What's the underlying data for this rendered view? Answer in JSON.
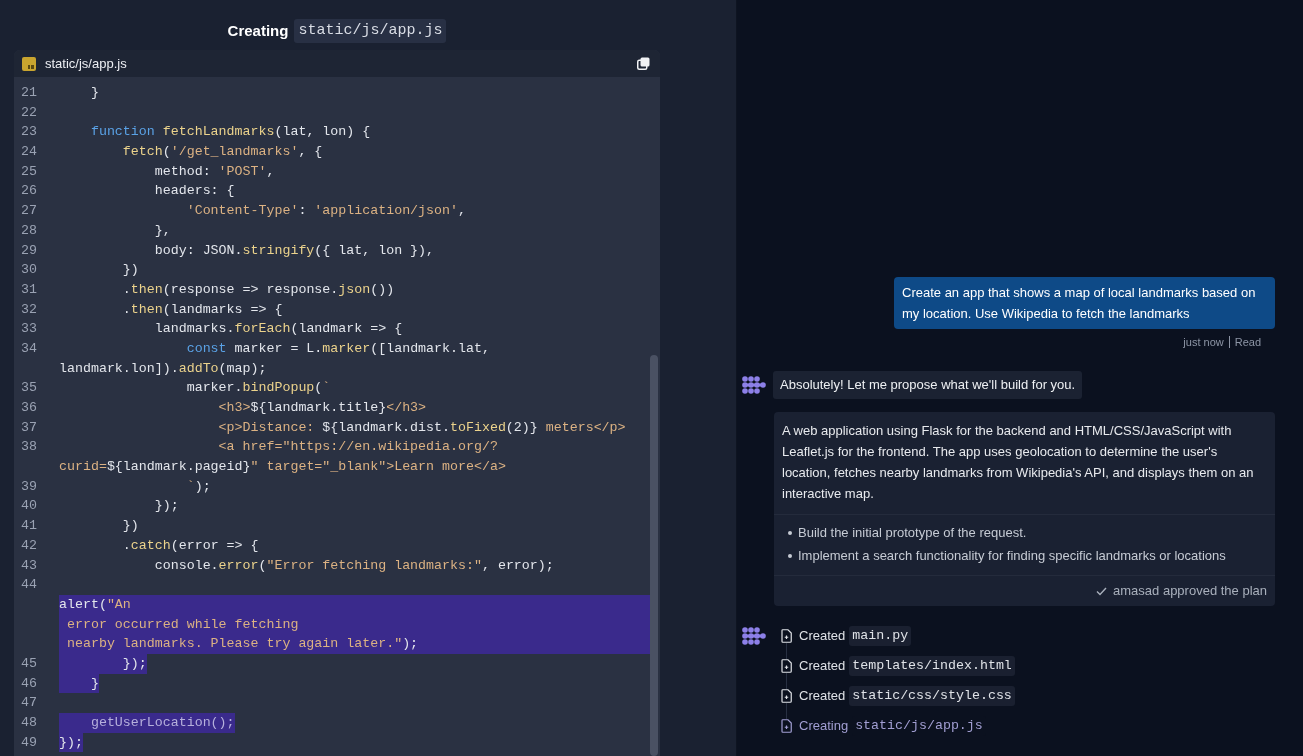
{
  "editor": {
    "heading": {
      "verb": "Creating",
      "path": "static/js/app.js"
    },
    "file_tab": {
      "name": "static/js/app.js"
    },
    "lines": [
      {
        "number": "21",
        "tokens": [
          {
            "text": "    }",
            "kind": "plain"
          }
        ]
      },
      {
        "number": "22"
      },
      {
        "number": "23",
        "tokens": [
          {
            "text": "    function",
            "kind": "keyword"
          },
          {
            "text": " fetchLandmarks",
            "kind": "function"
          },
          {
            "text": "(lat, lon) {",
            "kind": "plain"
          }
        ]
      },
      {
        "number": "24",
        "tokens": [
          {
            "text": "        fetch",
            "kind": "function"
          },
          {
            "text": "(",
            "kind": "plain"
          },
          {
            "text": "'/get_landmarks'",
            "kind": "string"
          },
          {
            "text": ", {",
            "kind": "plain"
          }
        ]
      },
      {
        "number": "25",
        "tokens": [
          {
            "text": "            method: ",
            "kind": "plain"
          },
          {
            "text": "'POST'",
            "kind": "string"
          },
          {
            "text": ",",
            "kind": "plain"
          }
        ]
      },
      {
        "number": "26",
        "tokens": [
          {
            "text": "            headers: {",
            "kind": "plain"
          }
        ]
      },
      {
        "number": "27",
        "tokens": [
          {
            "text": "                'Content-Type'",
            "kind": "string"
          },
          {
            "text": ": ",
            "kind": "plain"
          },
          {
            "text": "'application/json'",
            "kind": "string"
          },
          {
            "text": ",",
            "kind": "plain"
          }
        ]
      },
      {
        "number": "28",
        "tokens": [
          {
            "text": "            },",
            "kind": "plain"
          }
        ]
      },
      {
        "number": "29",
        "tokens": [
          {
            "text": "            body: JSON.",
            "kind": "plain"
          },
          {
            "text": "stringify",
            "kind": "function"
          },
          {
            "text": "({ lat, lon }),",
            "kind": "plain"
          }
        ]
      },
      {
        "number": "30",
        "tokens": [
          {
            "text": "        })",
            "kind": "plain"
          }
        ]
      },
      {
        "number": "31",
        "tokens": [
          {
            "text": "        .",
            "kind": "plain"
          },
          {
            "text": "then",
            "kind": "function"
          },
          {
            "text": "(response => response.",
            "kind": "plain"
          },
          {
            "text": "json",
            "kind": "function"
          },
          {
            "text": "())",
            "kind": "plain"
          }
        ]
      },
      {
        "number": "32",
        "tokens": [
          {
            "text": "        .",
            "kind": "plain"
          },
          {
            "text": "then",
            "kind": "function"
          },
          {
            "text": "(landmarks => {",
            "kind": "plain"
          }
        ]
      },
      {
        "number": "33",
        "tokens": [
          {
            "text": "            landmarks.",
            "kind": "plain"
          },
          {
            "text": "forEach",
            "kind": "function"
          },
          {
            "text": "(landmark => {",
            "kind": "plain"
          }
        ]
      },
      {
        "number": "34",
        "tokens": [
          {
            "text": "                const",
            "kind": "keyword"
          },
          {
            "text": " marker = L.",
            "kind": "plain"
          },
          {
            "text": "marker",
            "kind": "function"
          },
          {
            "text": "([landmark.lat,",
            "kind": "plain"
          }
        ]
      },
      {
        "tokens": [
          {
            "text": "landmark.lon]).",
            "kind": "plain"
          },
          {
            "text": "addTo",
            "kind": "function"
          },
          {
            "text": "(map);",
            "kind": "plain"
          }
        ]
      },
      {
        "number": "35",
        "tokens": [
          {
            "text": "                marker.",
            "kind": "plain"
          },
          {
            "text": "bindPopup",
            "kind": "function"
          },
          {
            "text": "(",
            "kind": "plain"
          },
          {
            "text": "`",
            "kind": "string"
          }
        ]
      },
      {
        "number": "36",
        "tokens": [
          {
            "text": "                    <h3>",
            "kind": "string"
          },
          {
            "text": "${landmark.title}",
            "kind": "plain"
          },
          {
            "text": "</h3>",
            "kind": "string"
          }
        ]
      },
      {
        "number": "37",
        "tokens": [
          {
            "text": "                    <p>Distance: ",
            "kind": "string"
          },
          {
            "text": "${landmark.dist.",
            "kind": "plain"
          },
          {
            "text": "toFixed",
            "kind": "function"
          },
          {
            "text": "(2)}",
            "kind": "plain"
          },
          {
            "text": " meters</p>",
            "kind": "string"
          }
        ]
      },
      {
        "number": "38",
        "tokens": [
          {
            "text": "                    <a href=\"https://en.wikipedia.org/?",
            "kind": "string"
          }
        ]
      },
      {
        "tokens": [
          {
            "text": "curid=",
            "kind": "string"
          },
          {
            "text": "${landmark.pageid}",
            "kind": "plain"
          },
          {
            "text": "\" target=\"_blank\">Learn more</a>",
            "kind": "string"
          }
        ]
      },
      {
        "number": "39",
        "tokens": [
          {
            "text": "                `",
            "kind": "string"
          },
          {
            "text": ");",
            "kind": "plain"
          }
        ]
      },
      {
        "number": "40",
        "tokens": [
          {
            "text": "            });",
            "kind": "plain"
          }
        ]
      },
      {
        "number": "41",
        "tokens": [
          {
            "text": "        })",
            "kind": "plain"
          }
        ]
      },
      {
        "number": "42",
        "tokens": [
          {
            "text": "        .",
            "kind": "plain"
          },
          {
            "text": "catch",
            "kind": "function"
          },
          {
            "text": "(error => {",
            "kind": "plain"
          }
        ]
      },
      {
        "number": "43",
        "tokens": [
          {
            "text": "            console.",
            "kind": "plain"
          },
          {
            "text": "error",
            "kind": "function"
          },
          {
            "text": "(",
            "kind": "plain"
          },
          {
            "text": "\"Error fetching landmarks:\"",
            "kind": "string"
          },
          {
            "text": ", error);",
            "kind": "plain"
          }
        ]
      },
      {
        "number": "44"
      },
      {
        "highlighted": true,
        "full_width": true,
        "tokens": [
          {
            "text": "alert(",
            "kind": "plain"
          },
          {
            "text": "\"An",
            "kind": "string"
          }
        ]
      },
      {
        "highlighted": true,
        "full_width": true,
        "tokens": [
          {
            "text": " error occurred while fetching",
            "kind": "string"
          }
        ]
      },
      {
        "highlighted": true,
        "full_width": true,
        "tokens": [
          {
            "text": " nearby landmarks. Please try again later.\"",
            "kind": "string"
          },
          {
            "text": ");",
            "kind": "plain"
          }
        ]
      },
      {
        "number": "45",
        "highlighted": true,
        "full_width": false,
        "tokens": [
          {
            "text": "        });",
            "kind": "plain"
          }
        ]
      },
      {
        "number": "46",
        "highlighted": true,
        "full_width": false,
        "tokens": [
          {
            "text": "    }",
            "kind": "plain"
          }
        ]
      },
      {
        "number": "47"
      },
      {
        "number": "48",
        "highlighted": true,
        "full_width": false,
        "tokens": [
          {
            "text": "    getUserLocation();",
            "kind": "faded"
          }
        ]
      },
      {
        "number": "49",
        "highlighted": true,
        "full_width": false,
        "tokens": [
          {
            "text": "});",
            "kind": "plain"
          }
        ]
      }
    ]
  },
  "chat": {
    "messages": [
      {
        "kind": "user",
        "text": "Create an app that shows a map of local landmarks based on my location. Use Wikipedia to fetch the landmarks",
        "time": "just now",
        "receipt": "Read"
      },
      {
        "kind": "agent",
        "text": "Absolutely! Let me propose what we'll build for you."
      },
      {
        "kind": "plan",
        "description": "A web application using Flask for the backend and HTML/CSS/JavaScript with Leaflet.js for the frontend. The app uses geolocation to determine the user's location, fetches nearby landmarks from Wikipedia's API, and displays them on an interactive map.",
        "steps": [
          "Build the initial prototype of the request.",
          "Implement a search functionality for finding specific landmarks or locations"
        ],
        "approval": "amasad approved the plan"
      },
      {
        "kind": "files",
        "items": [
          {
            "verb": "Created",
            "path": "main.py",
            "in_progress": false
          },
          {
            "verb": "Created",
            "path": "templates/index.html",
            "in_progress": false
          },
          {
            "verb": "Created",
            "path": "static/css/style.css",
            "in_progress": false
          },
          {
            "verb": "Creating",
            "path": "static/js/app.js",
            "in_progress": true
          }
        ]
      }
    ]
  }
}
